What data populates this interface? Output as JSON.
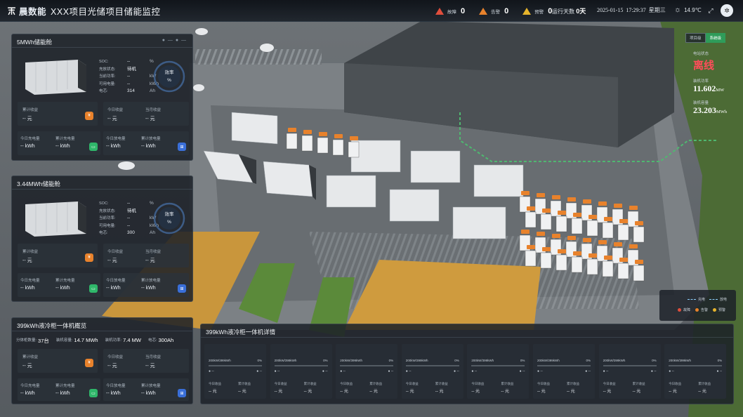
{
  "header": {
    "brand": "晨数能",
    "title": "XXX项目光储项目储能监控",
    "alerts": [
      {
        "name": "故障",
        "count": "0",
        "color": "#e04e3c"
      },
      {
        "name": "告警",
        "count": "0",
        "color": "#e8822c"
      },
      {
        "name": "预警",
        "count": "0",
        "color": "#e6b42c"
      }
    ],
    "run_label": "运行天数",
    "run_days": "0天",
    "date": "2025-01-15",
    "time": "17:29:37",
    "weekday": "星期三",
    "temperature": "14.9℃"
  },
  "panels": [
    {
      "title": "5MWh储能舱",
      "dots": "● — ● —",
      "metrics": [
        {
          "k": "SOC:",
          "v": "--",
          "u": "%"
        },
        {
          "k": "充放状态:",
          "v": "待机",
          "u": ""
        },
        {
          "k": "当前功率:",
          "v": "--",
          "u": "kW"
        },
        {
          "k": "可用电量:",
          "v": "--",
          "u": "kWh"
        },
        {
          "k": "电芯:",
          "v": "314",
          "u": "Ah"
        }
      ],
      "efficiency_label": "效率",
      "efficiency_unit": "%",
      "cards": [
        {
          "l1": "累计收益",
          "v1": "-- 元",
          "l2": "",
          "v2": "",
          "badge": "¥",
          "color": "orange"
        },
        {
          "l1": "今日收益",
          "v1": "-- 元",
          "l2": "当月收益",
          "v2": "-- 元",
          "badge": "",
          "color": ""
        },
        {
          "l1": "今日充电量",
          "v1": "-- kWh",
          "l2": "累计充电量",
          "v2": "-- kWh",
          "badge": "▭",
          "color": "green"
        },
        {
          "l1": "今日放电量",
          "v1": "-- kWh",
          "l2": "累计放电量",
          "v2": "-- kWh",
          "badge": "⊞",
          "color": "blue"
        }
      ]
    },
    {
      "title": "3.44MWh储能舱",
      "dots": "",
      "metrics": [
        {
          "k": "SOC:",
          "v": "--",
          "u": "%"
        },
        {
          "k": "充放状态:",
          "v": "待机",
          "u": ""
        },
        {
          "k": "当前功率:",
          "v": "--",
          "u": "kW"
        },
        {
          "k": "可用电量:",
          "v": "--",
          "u": "kWh"
        },
        {
          "k": "电芯:",
          "v": "300",
          "u": "Ah"
        }
      ],
      "efficiency_label": "效率",
      "efficiency_unit": "%",
      "cards": [
        {
          "l1": "累计收益",
          "v1": "-- 元",
          "l2": "",
          "v2": "",
          "badge": "¥",
          "color": "orange"
        },
        {
          "l1": "今日收益",
          "v1": "-- 元",
          "l2": "当月收益",
          "v2": "-- 元",
          "badge": "",
          "color": ""
        },
        {
          "l1": "今日充电量",
          "v1": "-- kWh",
          "l2": "累计充电量",
          "v2": "-- kWh",
          "badge": "▭",
          "color": "green"
        },
        {
          "l1": "今日放电量",
          "v1": "-- kWh",
          "l2": "累计放电量",
          "v2": "-- kWh",
          "badge": "⊞",
          "color": "blue"
        }
      ]
    }
  ],
  "overview": {
    "title": "399kWh液冷柜一体机概览",
    "stats": [
      {
        "k": "分体柜数量:",
        "v": "37台"
      },
      {
        "k": "装机容量:",
        "v": "14.7 MWh"
      },
      {
        "k": "装机功率:",
        "v": "7.4 MW"
      },
      {
        "k": "电芯:",
        "v": "300Ah"
      }
    ],
    "cards": [
      {
        "l1": "累计收益",
        "v1": "-- 元",
        "l2": "",
        "v2": "",
        "badge": "¥",
        "color": "orange"
      },
      {
        "l1": "今日收益",
        "v1": "-- 元",
        "l2": "当月收益",
        "v2": "-- 元",
        "badge": "",
        "color": ""
      },
      {
        "l1": "今日充电量",
        "v1": "-- kWh",
        "l2": "累计充电量",
        "v2": "-- kWh",
        "badge": "▭",
        "color": "green"
      },
      {
        "l1": "今日放电量",
        "v1": "-- kWh",
        "l2": "累计放电量",
        "v2": "-- kWh",
        "badge": "⊞",
        "color": "blue"
      }
    ]
  },
  "right": {
    "tabs": [
      "项目级",
      "系统级"
    ],
    "station_status_label": "电站状态",
    "station_status": "离线",
    "power_label": "装机功率",
    "power": "11.602",
    "power_unit": "MW",
    "capacity_label": "装机容量",
    "capacity": "23.203",
    "capacity_unit": "MWh",
    "legend_lines": [
      "充电",
      "放电"
    ],
    "legend_dots": [
      {
        "name": "故障",
        "color": "#e04e3c"
      },
      {
        "name": "告警",
        "color": "#e8822c"
      },
      {
        "name": "预警",
        "color": "#e6b42c"
      }
    ]
  },
  "detail": {
    "title": "399kWh液冷柜一体机详情",
    "units": [
      {
        "spec": "200kW/399kWh",
        "pct": "0%",
        "soc": 0
      },
      {
        "spec": "200kW/399kWh",
        "pct": "0%",
        "soc": 0
      },
      {
        "spec": "200kW/399kWh",
        "pct": "0%",
        "soc": 0
      },
      {
        "spec": "200kW/399kWh",
        "pct": "0%",
        "soc": 0
      },
      {
        "spec": "200kW/399kWh",
        "pct": "0%",
        "soc": 0
      },
      {
        "spec": "200kW/399kWh",
        "pct": "0%",
        "soc": 0
      },
      {
        "spec": "200kW/399kWh",
        "pct": "0%",
        "soc": 0
      },
      {
        "spec": "200kW/399kWh",
        "pct": "0%",
        "soc": 0
      }
    ],
    "dash": "● --",
    "today_label": "今日收益",
    "total_label": "累计收益",
    "today_value": "-- 元",
    "total_value": "-- 元"
  },
  "colors": {
    "accent": "#2f9c5a",
    "offline": "#ff4d5a",
    "orange": "#e8822c"
  }
}
